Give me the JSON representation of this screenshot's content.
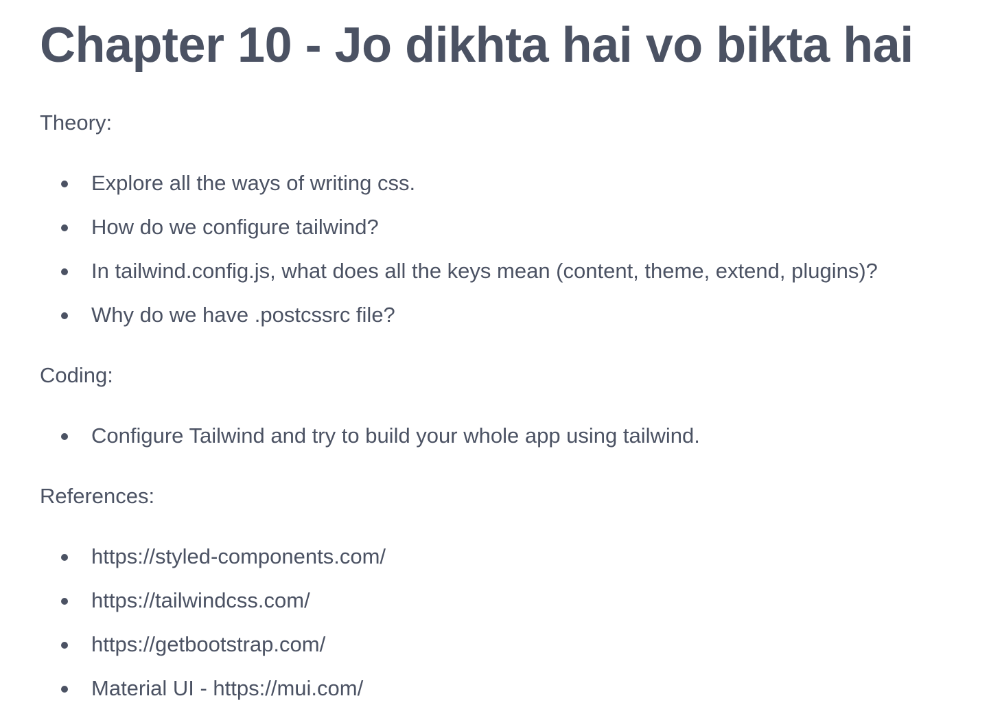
{
  "document": {
    "title": "Chapter 10 - Jo dikhta hai vo bikta hai",
    "theory": {
      "label": "Theory:",
      "items": [
        "Explore all the ways of writing css.",
        "How do we configure tailwind?",
        "In tailwind.config.js, what does all the keys mean (content, theme, extend, plugins)?",
        "Why do we have .postcssrc file?"
      ]
    },
    "coding": {
      "label": "Coding:",
      "items": [
        "Configure Tailwind and try to build your whole app using tailwind."
      ]
    },
    "references": {
      "label": "References:",
      "items": [
        "https://styled-components.com/",
        "https://tailwindcss.com/",
        "https://getbootstrap.com/",
        "Material UI - https://mui.com/"
      ]
    }
  },
  "colors": {
    "text": "#4b5263",
    "background": "#ffffff"
  }
}
